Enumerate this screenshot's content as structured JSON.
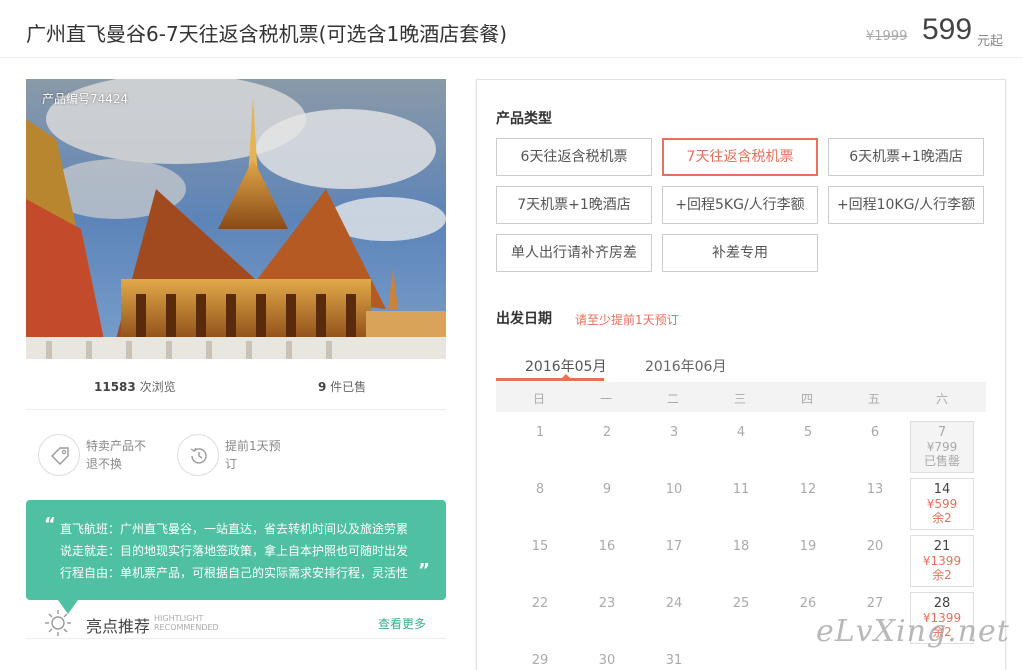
{
  "header": {
    "title": "广州直飞曼谷6-7天往返含税机票(可选含1晚酒店套餐)",
    "old_price": "¥1999",
    "price": "599",
    "price_unit": "元起"
  },
  "photo": {
    "product_code": "产品编号74424"
  },
  "stats": {
    "views_count": "11583",
    "views_label": " 次浏览",
    "sold_count": "9",
    "sold_label": " 件已售"
  },
  "features": [
    {
      "icon": "tag-icon",
      "text": "特卖产品不退不换"
    },
    {
      "icon": "clock-history-icon",
      "text": "提前1天预订"
    }
  ],
  "quote": {
    "lines": [
      "直飞航班：广州直飞曼谷，一站直达，省去转机时间以及旅途劳累",
      "说走就走：目的地现实行落地签政策，拿上自本护照也可随时出发",
      "行程自由：单机票产品，可根据自己的实际需求安排行程，灵活性"
    ]
  },
  "highlight": {
    "title": "亮点推荐",
    "en_line1": "HIGHTLIGHT",
    "en_line2": "RECOMMENDED",
    "more": "查看更多"
  },
  "product_type": {
    "title": "产品类型",
    "options": [
      "6天往返含税机票",
      "7天往返含税机票",
      "6天机票+1晚酒店",
      "7天机票+1晚酒店",
      "+回程5KG/人行李额",
      "+回程10KG/人行李额",
      "单人出行请补齐房差",
      "补差专用"
    ],
    "selected_index": 1
  },
  "departure": {
    "title": "出发日期",
    "hint": "请至少提前1天预订",
    "months": [
      "2016年05月",
      "2016年06月"
    ],
    "active_month": 0,
    "weekdays": [
      "日",
      "一",
      "二",
      "三",
      "四",
      "五",
      "六"
    ],
    "days": {
      "d1": "1",
      "d2": "2",
      "d3": "3",
      "d4": "4",
      "d5": "5",
      "d6": "6",
      "d8": "8",
      "d9": "9",
      "d10": "10",
      "d11": "11",
      "d12": "12",
      "d13": "13",
      "d15": "15",
      "d16": "16",
      "d17": "17",
      "d18": "18",
      "d19": "19",
      "d20": "20",
      "d22": "22",
      "d23": "23",
      "d24": "24",
      "d25": "25",
      "d26": "26",
      "d27": "27",
      "d29": "29",
      "d30": "30",
      "d31": "31"
    },
    "available": [
      {
        "day": "7",
        "price": "¥799",
        "status": "已售罄"
      },
      {
        "day": "14",
        "price": "¥599",
        "status": "余2"
      },
      {
        "day": "21",
        "price": "¥1399",
        "status": "余2"
      },
      {
        "day": "28",
        "price": "¥1399",
        "status": "余2"
      }
    ]
  },
  "watermark": "eLvXing.net",
  "colors": {
    "accent": "#e8705a",
    "teal": "#4fc1a2"
  }
}
